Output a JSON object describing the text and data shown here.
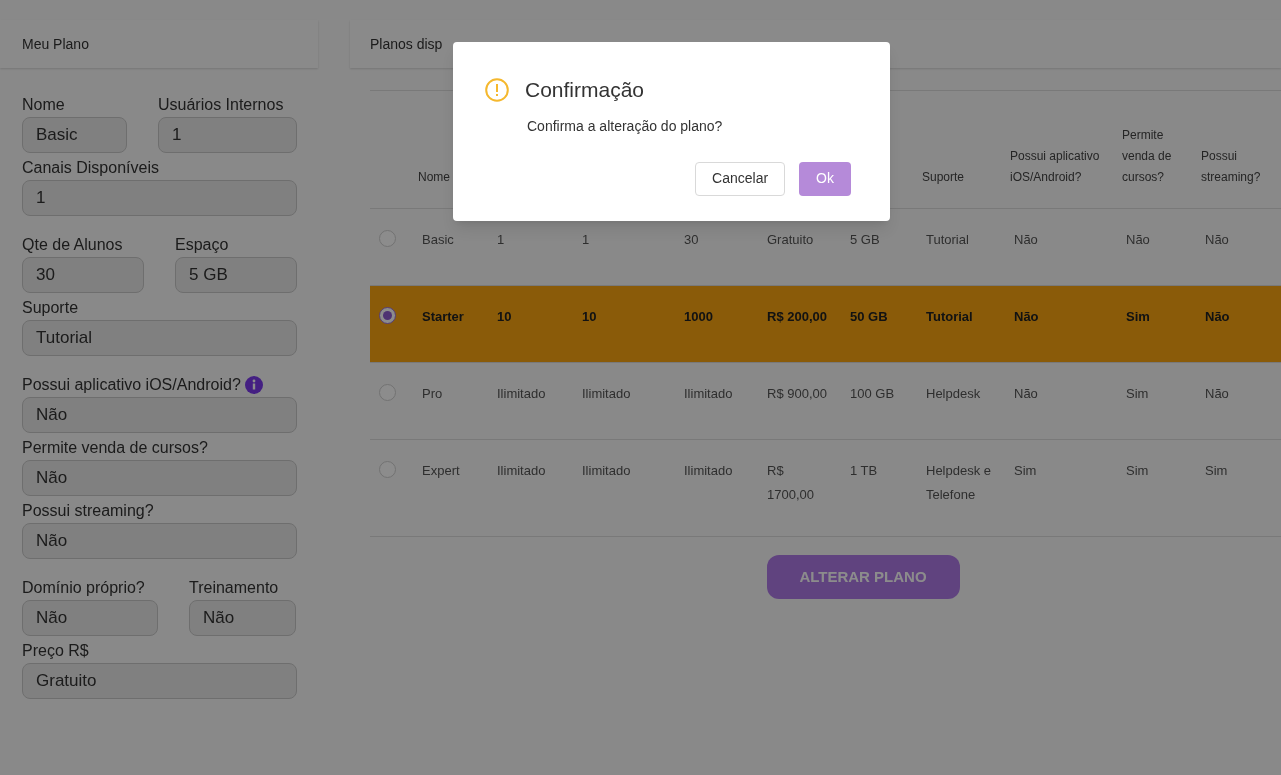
{
  "my_plan": {
    "title": "Meu Plano",
    "sections": [
      [
        [
          {
            "label": "Nome",
            "value": "Basic"
          },
          {
            "label": "Usuários Internos",
            "value": "1"
          }
        ],
        [
          {
            "label": "Canais Disponíveis",
            "value": "1"
          }
        ]
      ],
      [
        [
          {
            "label": "Qte de Alunos",
            "value": "30"
          },
          {
            "label": "Espaço",
            "value": "5 GB"
          }
        ],
        [
          {
            "label": "Suporte",
            "value": "Tutorial"
          }
        ]
      ],
      [
        [
          {
            "label": "Possui aplicativo iOS/Android?",
            "value": "Não",
            "info": true
          }
        ],
        [
          {
            "label": "Permite venda de cursos?",
            "value": "Não"
          }
        ],
        [
          {
            "label": "Possui streaming?",
            "value": "Não"
          }
        ]
      ],
      [
        [
          {
            "label": "Domínio próprio?",
            "value": "Não"
          },
          {
            "label": "Treinamento",
            "value": "Não"
          }
        ],
        [
          {
            "label": "Preço R$",
            "value": "Gratuito"
          }
        ]
      ]
    ]
  },
  "plans": {
    "title": "Planos disp",
    "columns": [
      {
        "kind": "label",
        "label": "Nome"
      },
      {
        "kind": "covered"
      },
      {
        "kind": "covered"
      },
      {
        "kind": "covered"
      },
      {
        "kind": "covered"
      },
      {
        "kind": "covered"
      },
      {
        "kind": "label",
        "label": "Suporte"
      },
      {
        "kind": "label",
        "label": "Possui aplicativo iOS/Android?"
      },
      {
        "kind": "label",
        "label": "Permite venda de cursos?"
      },
      {
        "kind": "label",
        "label": "Possui streaming?"
      }
    ],
    "rows": [
      {
        "selected": false,
        "cells": [
          "Basic",
          "1",
          "1",
          "30",
          "Gratuito",
          "5 GB",
          "Tutorial",
          "Não",
          "Não",
          "Não"
        ]
      },
      {
        "selected": true,
        "cells": [
          "Starter",
          "10",
          "10",
          "1000",
          "R$ 200,00",
          "50 GB",
          "Tutorial",
          "Não",
          "Sim",
          "Não"
        ]
      },
      {
        "selected": false,
        "cells": [
          "Pro",
          "Ilimitado",
          "Ilimitado",
          "Ilimitado",
          "R$ 900,00",
          "100 GB",
          "Helpdesk",
          "Não",
          "Sim",
          "Não"
        ]
      },
      {
        "selected": false,
        "cells": [
          "Expert",
          "Ilimitado",
          "Ilimitado",
          "Ilimitado",
          "R$ 1700,00",
          "1 TB",
          "Helpdesk e Telefone",
          "Sim",
          "Sim",
          "Sim"
        ]
      }
    ],
    "button": "ALTERAR PLANO"
  },
  "dialog": {
    "title": "Confirmação",
    "message": "Confirma a alteração do plano?",
    "buttons": [
      {
        "kind": "secondary",
        "label": "Cancelar"
      },
      {
        "kind": "primary",
        "label": "Ok"
      }
    ]
  }
}
